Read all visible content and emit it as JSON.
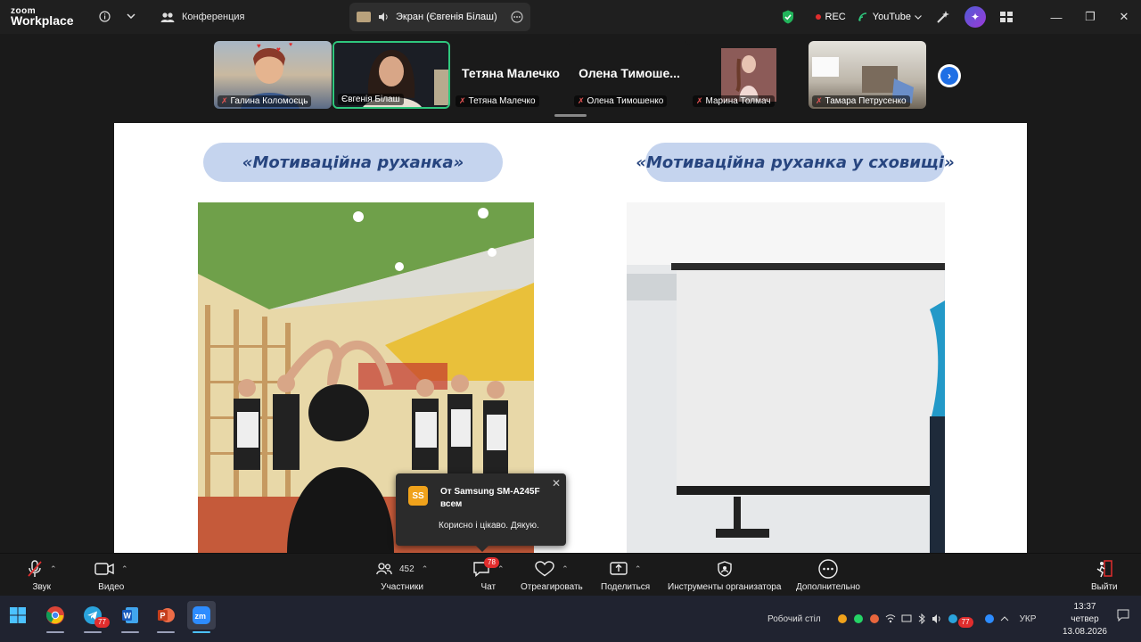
{
  "app": {
    "logo_line1": "zoom",
    "logo_line2": "Workplace"
  },
  "topbar": {
    "conference_tab": "Конференция",
    "screen_tab": "Экран (Євгенія Білаш)",
    "rec_label": "REC",
    "youtube_label": "YouTube",
    "accent_green": "#2fc77d",
    "rec_red": "#e02d2d"
  },
  "gallery": {
    "participants": [
      {
        "name": "Галина Коломоєць",
        "video": true
      },
      {
        "name": "Євгенія Білаш",
        "video": true,
        "active": true
      },
      {
        "name": "Тетяна Малечко",
        "big_name": "Тетяна Малечко",
        "video": false
      },
      {
        "name": "Олена Тимошенко",
        "big_name": "Олена  Тимоше...",
        "video": false
      },
      {
        "name": "Марина Толмач",
        "video": true
      },
      {
        "name": "Тамара Петрусенко",
        "video": true
      }
    ]
  },
  "slide": {
    "title_left": "«Мотиваційна руханка»",
    "title_right": "«Мотиваційна руханка у сховищі»",
    "pill_color": "#c5d4ee",
    "title_color": "#27457f"
  },
  "toast": {
    "avatar": "SS",
    "from": "От Samsung SM-A245F всем",
    "message": "Корисно і цікаво. Дякую."
  },
  "controls": {
    "audio": "Звук",
    "video": "Видео",
    "participants": "Участники",
    "participants_count": "452",
    "chat": "Чат",
    "chat_badge": "78",
    "react": "Отреагировать",
    "share": "Поделиться",
    "host_tools": "Инструменты организатора",
    "more": "Дополнительно",
    "leave": "Выйти"
  },
  "taskbar": {
    "desktop_label": "Робочий стіл",
    "lang": "УКР",
    "time": "13:37",
    "day": "четвер",
    "date": "13.08.2026",
    "telegram_badge": "77",
    "tray_badge": "77"
  }
}
